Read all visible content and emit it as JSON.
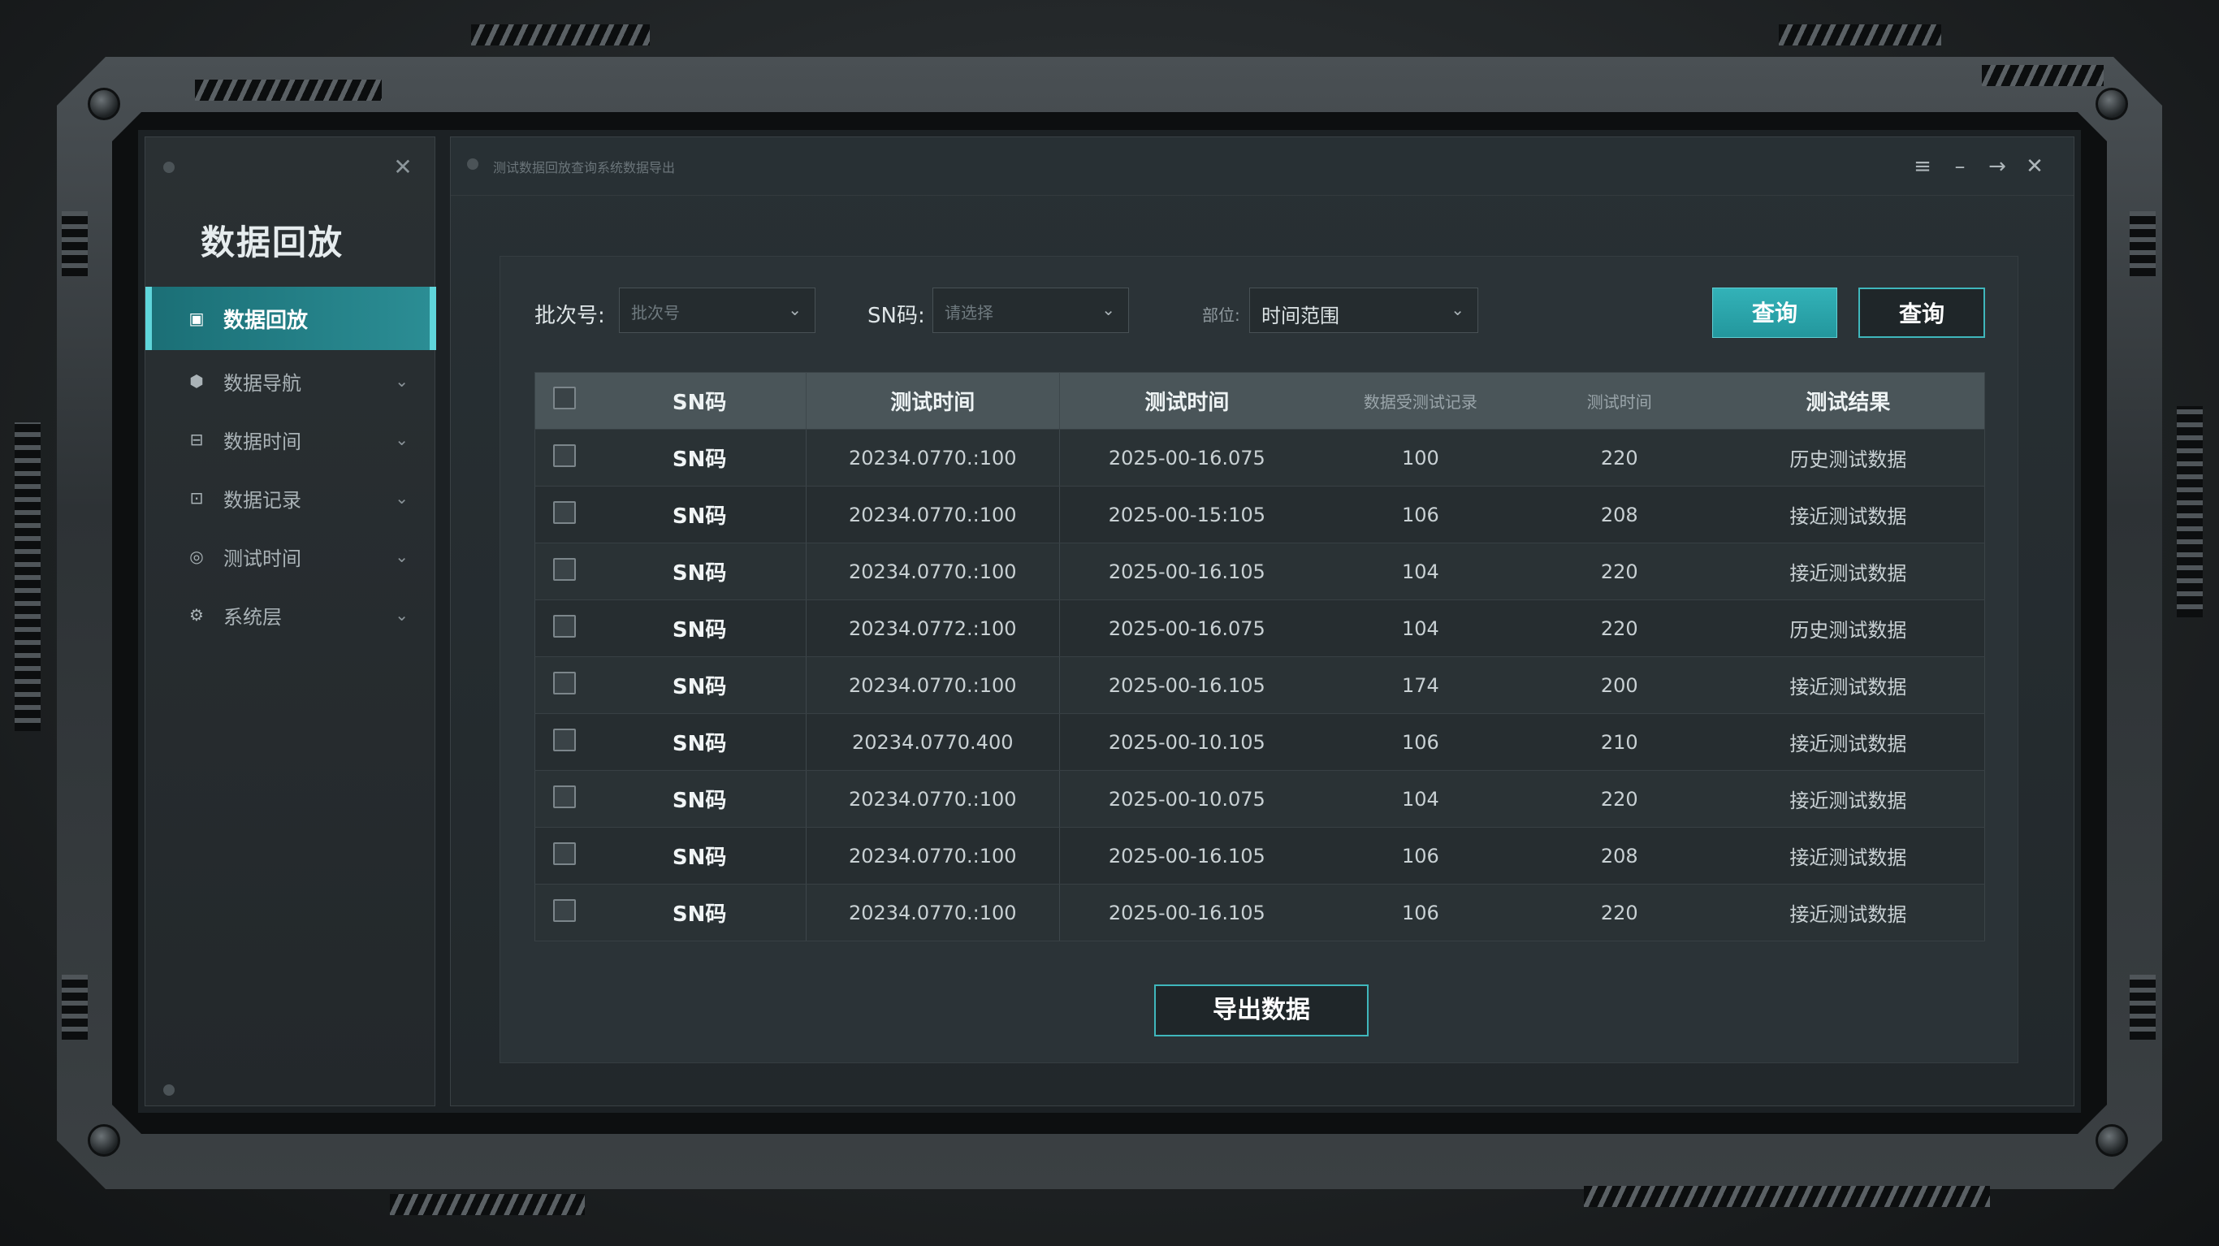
{
  "colors": {
    "accent": "#2ba7ad",
    "accent_border": "#5fd6db",
    "panel_bg": "#2b3337",
    "header_bg": "#4a5559"
  },
  "sidebar": {
    "title": "数据回放",
    "collapse_icon": "close-icon",
    "items": [
      {
        "label": "数据回放",
        "icon": "database-icon",
        "active": true
      },
      {
        "label": "数据导航",
        "icon": "navigation-icon",
        "active": false
      },
      {
        "label": "数据时间",
        "icon": "clock-icon",
        "active": false
      },
      {
        "label": "数据记录",
        "icon": "record-icon",
        "active": false
      },
      {
        "label": "测试时间",
        "icon": "timer-icon",
        "active": false
      },
      {
        "label": "系统层",
        "icon": "layers-icon",
        "active": false
      }
    ]
  },
  "window": {
    "title": "测试数据回放查询系统数据导出",
    "controls": [
      "menu-icon",
      "minimize-icon",
      "maximize-icon",
      "close-icon"
    ]
  },
  "filters": {
    "batch_label": "批次号:",
    "batch_placeholder": "批次号",
    "sn_label": "SN码:",
    "sn_placeholder": "请选择",
    "part_label": "部位:",
    "time_value": "时间范围",
    "query_primary": "查询",
    "query_secondary": "查询"
  },
  "table": {
    "headers": [
      "SN码",
      "测试时间",
      "测试时间",
      "数据受测试记录",
      "测试时间",
      "测试结果"
    ],
    "rows": [
      {
        "sn": "SN码",
        "t1": "20234.0770.:100",
        "t2": "2025-00-16.075",
        "v1": "100",
        "v2": "220",
        "result": "历史测试数据"
      },
      {
        "sn": "SN码",
        "t1": "20234.0770.:100",
        "t2": "2025-00-15:105",
        "v1": "106",
        "v2": "208",
        "result": "接近测试数据"
      },
      {
        "sn": "SN码",
        "t1": "20234.0770.:100",
        "t2": "2025-00-16.105",
        "v1": "104",
        "v2": "220",
        "result": "接近测试数据"
      },
      {
        "sn": "SN码",
        "t1": "20234.0772.:100",
        "t2": "2025-00-16.075",
        "v1": "104",
        "v2": "220",
        "result": "历史测试数据"
      },
      {
        "sn": "SN码",
        "t1": "20234.0770.:100",
        "t2": "2025-00-16.105",
        "v1": "174",
        "v2": "200",
        "result": "接近测试数据"
      },
      {
        "sn": "SN码",
        "t1": "20234.0770.400",
        "t2": "2025-00-10.105",
        "v1": "106",
        "v2": "210",
        "result": "接近测试数据"
      },
      {
        "sn": "SN码",
        "t1": "20234.0770.:100",
        "t2": "2025-00-10.075",
        "v1": "104",
        "v2": "220",
        "result": "接近测试数据"
      },
      {
        "sn": "SN码",
        "t1": "20234.0770.:100",
        "t2": "2025-00-16.105",
        "v1": "106",
        "v2": "208",
        "result": "接近测试数据"
      },
      {
        "sn": "SN码",
        "t1": "20234.0770.:100",
        "t2": "2025-00-16.105",
        "v1": "106",
        "v2": "220",
        "result": "接近测试数据"
      }
    ]
  },
  "export_label": "导出数据"
}
